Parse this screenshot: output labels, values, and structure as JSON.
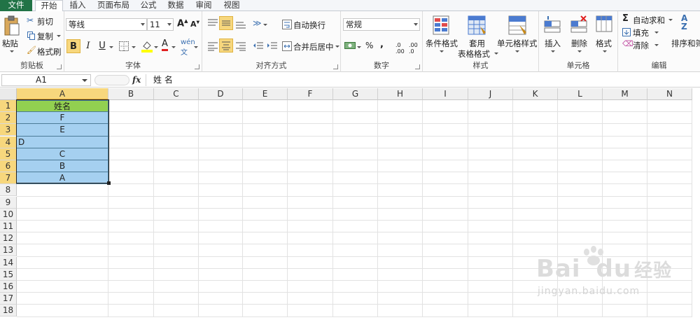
{
  "tabs": [
    {
      "label": "文件"
    },
    {
      "label": "开始"
    },
    {
      "label": "插入"
    },
    {
      "label": "页面布局"
    },
    {
      "label": "公式"
    },
    {
      "label": "数据"
    },
    {
      "label": "审阅"
    },
    {
      "label": "视图"
    }
  ],
  "ribbon": {
    "clipboard": {
      "group_label": "剪贴板",
      "paste": "粘贴",
      "cut": "剪切",
      "copy": "复制",
      "format_painter": "格式刷"
    },
    "font": {
      "group_label": "字体",
      "font_name": "等线",
      "font_size": "11"
    },
    "alignment": {
      "group_label": "对齐方式",
      "wrap": "自动换行",
      "merge": "合并后居中"
    },
    "number": {
      "group_label": "数字",
      "format": "常规",
      "percent": "%",
      "comma": ",",
      "inc": "+.0 .00",
      "dec": ".00 →.0"
    },
    "styles": {
      "group_label": "样式",
      "conditional": "条件格式",
      "table_line1": "套用",
      "table_line2": "表格格式",
      "cell_styles": "单元格样式"
    },
    "cells": {
      "group_label": "单元格",
      "insert": "插入",
      "delete": "删除",
      "format": "格式"
    },
    "editing": {
      "group_label": "编辑",
      "autosum": "自动求和",
      "fill": "填充",
      "clear": "清除",
      "sort": "排序和筛"
    }
  },
  "formula_bar": {
    "name_box": "A1",
    "fx": "fx",
    "content": "姓 名"
  },
  "columns": [
    "A",
    "B",
    "C",
    "D",
    "E",
    "F",
    "G",
    "H",
    "I",
    "J",
    "K",
    "L",
    "M",
    "N"
  ],
  "rows": [
    "1",
    "2",
    "3",
    "4",
    "5",
    "6",
    "7",
    "8",
    "9",
    "10",
    "11",
    "12",
    "13",
    "14",
    "15",
    "16",
    "17",
    "18"
  ],
  "cells_A": [
    "姓名",
    "F",
    "E",
    "D",
    "C",
    "B",
    "A"
  ],
  "colors": {
    "header_fill": "#92d050",
    "data_fill": "#a5d0f0",
    "selection": "#f7d77d",
    "file_tab": "#217346"
  },
  "watermark": {
    "brand": "Bai",
    "brand2": "du",
    "suffix": "经验",
    "url": "jingyan.baidu.com"
  }
}
